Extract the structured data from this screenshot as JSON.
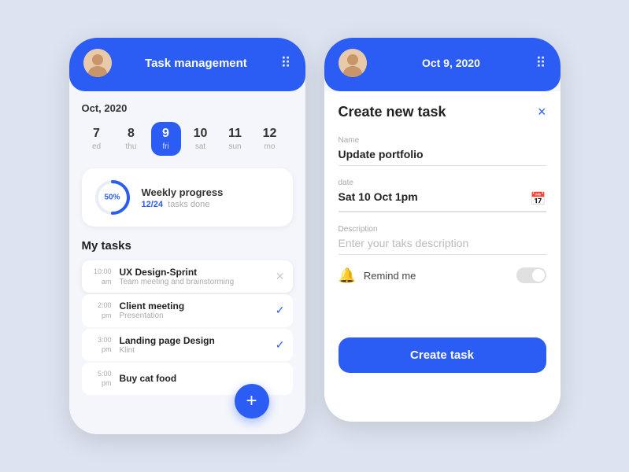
{
  "phone1": {
    "header": {
      "title": "Task management",
      "grid_icon": "⠿"
    },
    "month_label": "Oct,",
    "year": "2020",
    "calendar": [
      {
        "num": "7",
        "name": "ed",
        "active": false
      },
      {
        "num": "8",
        "name": "thu",
        "active": false
      },
      {
        "num": "9",
        "name": "fri",
        "active": true
      },
      {
        "num": "10",
        "name": "sat",
        "active": false
      },
      {
        "num": "11",
        "name": "sun",
        "active": false
      },
      {
        "num": "12",
        "name": "mo",
        "active": false
      }
    ],
    "progress": {
      "percent": 50,
      "label": "Weekly progress",
      "done": "12/24",
      "done_suffix": "tasks done"
    },
    "tasks_title": "My tasks",
    "tasks": [
      {
        "time_top": "10:00",
        "time_bot": "am",
        "name": "UX Design-Sprint",
        "sub": "Team meeting and brainstorming",
        "icon": "cross"
      },
      {
        "time_top": "2:00",
        "time_bot": "pm",
        "name": "Client meeting",
        "sub": "Presentation",
        "icon": "check"
      },
      {
        "time_top": "3:00",
        "time_bot": "pm",
        "name": "Landing page Design",
        "sub": "Klint",
        "icon": "check"
      },
      {
        "time_top": "5:00",
        "time_bot": "pm",
        "name": "Buy cat food",
        "sub": "",
        "icon": "none"
      }
    ],
    "fab_label": "+"
  },
  "phone2": {
    "header": {
      "date": "Oct 9, 2020",
      "grid_icon": "⠿"
    },
    "form": {
      "title": "Create new task",
      "close_icon": "×",
      "name_label": "Name",
      "name_value": "Update portfolio",
      "date_label": "date",
      "date_value": "Sat 10 Oct  1pm",
      "desc_label": "Description",
      "desc_placeholder": "Enter your taks description",
      "remind_label": "Remind me",
      "submit_label": "Create task"
    }
  }
}
